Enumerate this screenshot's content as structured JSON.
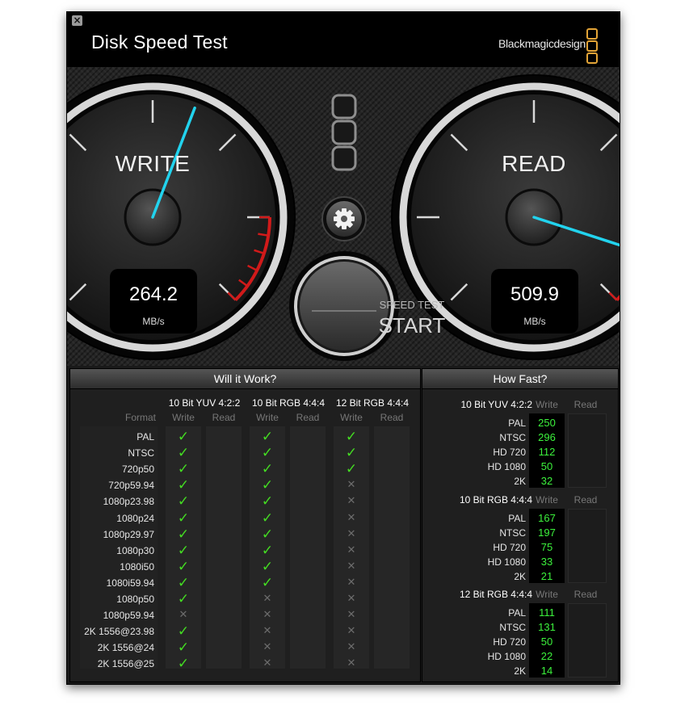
{
  "title": "Disk Speed Test",
  "brand": "Blackmagicdesign",
  "colors": {
    "accent": "#e3a437",
    "needle": "#22d3ee",
    "check": "#44dd22",
    "red": "#d11a1a"
  },
  "write_gauge": {
    "label": "WRITE",
    "value": "264.2",
    "unit": "MB/s",
    "needle_fraction": 0.578
  },
  "read_gauge": {
    "label": "READ",
    "value": "509.9",
    "unit": "MB/s",
    "needle_fraction": 0.9
  },
  "start_button": {
    "line1": "SPEED TEST",
    "line2": "START"
  },
  "icons": {
    "settings": "gear-icon",
    "close": "close-icon",
    "presets": "preset-slot-icon"
  },
  "will_it_work": {
    "title": "Will it Work?",
    "format_header": "Format",
    "write_label": "Write",
    "read_label": "Read",
    "groups": [
      "10 Bit YUV 4:2:2",
      "10 Bit RGB 4:4:4",
      "12 Bit RGB 4:4:4"
    ],
    "formats": [
      "PAL",
      "NTSC",
      "720p50",
      "720p59.94",
      "1080p23.98",
      "1080p24",
      "1080p29.97",
      "1080p30",
      "1080i50",
      "1080i59.94",
      "1080p50",
      "1080p59.94",
      "2K 1556@23.98",
      "2K 1556@24",
      "2K 1556@25"
    ],
    "results": [
      [
        1,
        1,
        1,
        1,
        1,
        1,
        1,
        1,
        1,
        1,
        1,
        0,
        1,
        1,
        1
      ],
      [
        1,
        1,
        1,
        1,
        1,
        1,
        1,
        1,
        1,
        1,
        0,
        0,
        0,
        0,
        0
      ],
      [
        1,
        1,
        1,
        0,
        0,
        0,
        0,
        0,
        0,
        0,
        0,
        0,
        0,
        0,
        0
      ]
    ]
  },
  "how_fast": {
    "title": "How Fast?",
    "write_label": "Write",
    "read_label": "Read",
    "rows": [
      "PAL",
      "NTSC",
      "HD 720",
      "HD 1080",
      "2K"
    ],
    "groups": [
      {
        "name": "10 Bit YUV 4:2:2",
        "write": [
          "250",
          "296",
          "112",
          "50",
          "32"
        ]
      },
      {
        "name": "10 Bit RGB 4:4:4",
        "write": [
          "167",
          "197",
          "75",
          "33",
          "21"
        ]
      },
      {
        "name": "12 Bit RGB 4:4:4",
        "write": [
          "111",
          "131",
          "50",
          "22",
          "14"
        ]
      }
    ]
  }
}
